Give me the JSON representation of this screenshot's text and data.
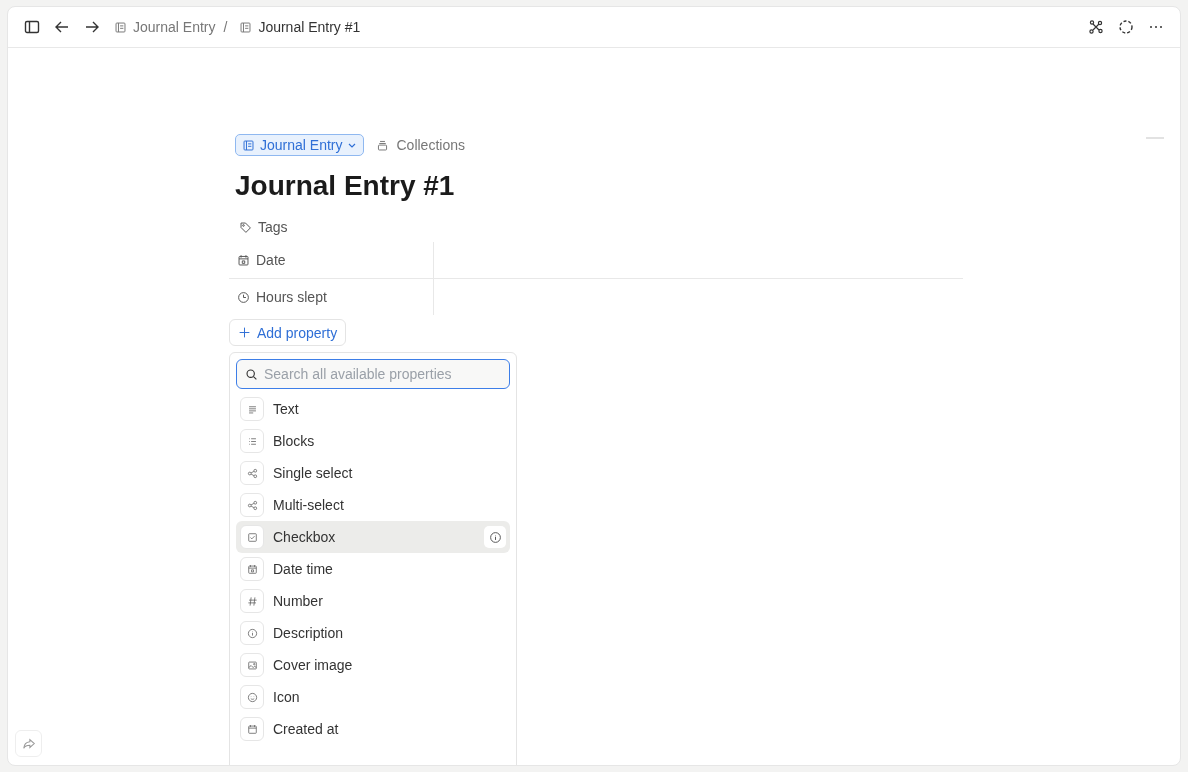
{
  "breadcrumb_separator": "/",
  "breadcrumb": [
    {
      "label": "Journal Entry",
      "current": false
    },
    {
      "label": "Journal Entry #1",
      "current": true
    }
  ],
  "type_tag": {
    "label": "Journal Entry"
  },
  "collections": {
    "label": "Collections"
  },
  "title": "Journal Entry #1",
  "properties": [
    {
      "kind": "tags",
      "label": "Tags"
    },
    {
      "kind": "date",
      "label": "Date"
    },
    {
      "kind": "clock",
      "label": "Hours slept"
    }
  ],
  "add_property": {
    "label": "Add property"
  },
  "menu": {
    "search": {
      "placeholder": "Search all available properties"
    },
    "items": [
      {
        "kind": "text",
        "label": "Text",
        "selected": false
      },
      {
        "kind": "blocks",
        "label": "Blocks",
        "selected": false
      },
      {
        "kind": "select",
        "label": "Single select",
        "selected": false
      },
      {
        "kind": "select",
        "label": "Multi-select",
        "selected": false
      },
      {
        "kind": "checkbox",
        "label": "Checkbox",
        "selected": true
      },
      {
        "kind": "date",
        "label": "Date time",
        "selected": false
      },
      {
        "kind": "number",
        "label": "Number",
        "selected": false
      },
      {
        "kind": "info",
        "label": "Description",
        "selected": false
      },
      {
        "kind": "image",
        "label": "Cover image",
        "selected": false
      },
      {
        "kind": "smile",
        "label": "Icon",
        "selected": false
      },
      {
        "kind": "calendar",
        "label": "Created at",
        "selected": false
      }
    ]
  }
}
